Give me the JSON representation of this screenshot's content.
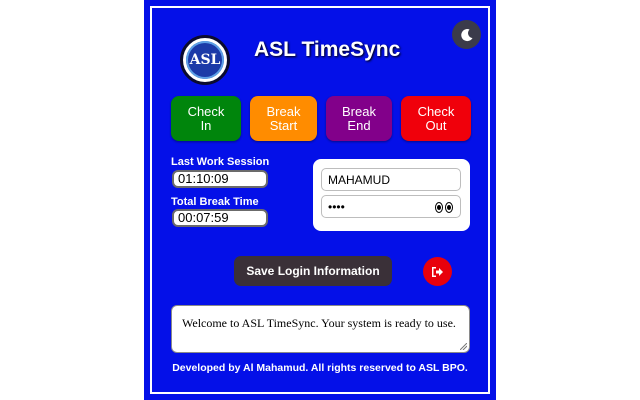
{
  "app": {
    "title": "ASL TimeSync",
    "logo_text": "ASL",
    "footer": "Developed by Al Mahamud. All rights reserved to ASL BPO."
  },
  "theme_toggle": {
    "icon": "moon-icon"
  },
  "actions": [
    {
      "label": "Check\nIn",
      "color": "#00850c"
    },
    {
      "label": "Break\nStart",
      "color": "#ff8c00"
    },
    {
      "label": "Break\nEnd",
      "color": "#82008a"
    },
    {
      "label": "Check\nOut",
      "color": "#f0000b"
    }
  ],
  "stats": {
    "last_session_label": "Last Work Session",
    "last_session_value": "01:10:09",
    "break_label": "Total Break Time",
    "break_value": "00:07:59"
  },
  "login": {
    "username": "MAHAMUD",
    "password_masked": "••••",
    "eye_icon": "eyes-icon"
  },
  "save_button": "Save Login Information",
  "logout_icon": "logout-icon",
  "status_message": "Welcome to ASL TimeSync. Your system is ready to use.",
  "colors": {
    "panel_bg": "#0410e8",
    "text": "#ffffff"
  }
}
